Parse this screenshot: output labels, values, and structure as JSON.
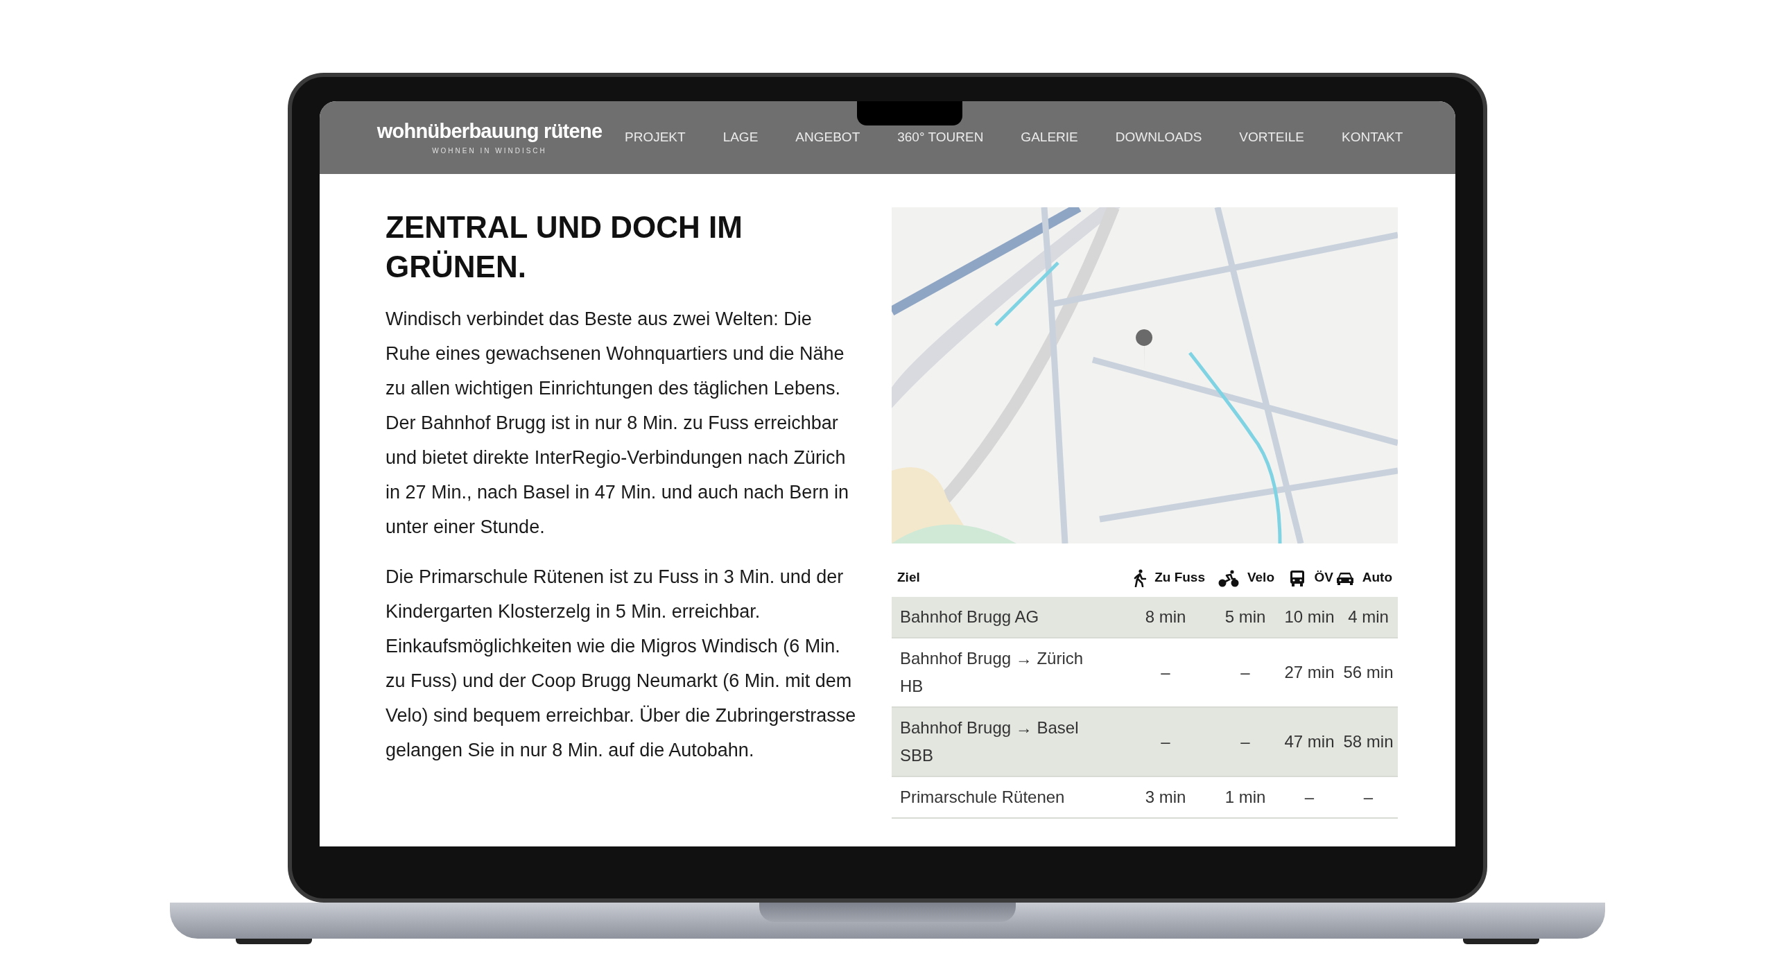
{
  "nav": {
    "logo": "wohnüberbauung rütene",
    "tagline": "WOHNEN IN WINDISCH",
    "items": [
      "PROJEKT",
      "LAGE",
      "ANGEBOT",
      "360° TOUREN",
      "GALERIE",
      "DOWNLOADS",
      "VORTEILE",
      "KONTAKT"
    ]
  },
  "heading": "ZENTRAL UND DOCH IM GRÜNEN.",
  "paragraphs": [
    "Windisch verbindet das Beste aus zwei Welten: Die Ruhe eines gewachsenen Wohnquartiers und die Nähe zu allen wichtigen Einrichtungen des täglichen Lebens. Der Bahnhof Brugg ist in nur 8 Min. zu Fuss erreichbar und bietet direkte InterRegio-Verbindungen nach Zürich in 27 Min., nach Basel in 47 Min. und auch nach Bern in unter einer Stunde.",
    "Die Primarschule Rütenen ist zu Fuss in 3 Min. und der Kindergarten Klosterzelg in 5 Min. erreichbar. Einkaufsmöglichkeiten wie die Migros Windisch (6 Min. zu Fuss) und der Coop Brugg Neumarkt (6 Min. mit dem Velo) sind bequem erreichbar. Über die Zubringerstrasse gelangen Sie in nur 8 Min. auf die Autobahn."
  ],
  "table": {
    "columns": [
      {
        "label": "Ziel"
      },
      {
        "label": "Zu Fuss"
      },
      {
        "label": "Velo"
      },
      {
        "label": "ÖV"
      },
      {
        "label": "Auto"
      }
    ],
    "rows": [
      {
        "cells": [
          "Bahnhof Brugg AG",
          "8 min",
          "5 min",
          "10 min",
          "4 min"
        ]
      },
      {
        "cells": [
          "Bahnhof Brugg → Zürich HB",
          "–",
          "–",
          "27 min",
          "56 min"
        ]
      },
      {
        "cells": [
          "Bahnhof Brugg → Basel SBB",
          "–",
          "–",
          "47 min",
          "58 min"
        ]
      },
      {
        "cells": [
          "Primarschule Rütenen",
          "3 min",
          "1 min",
          "–",
          "–"
        ]
      }
    ]
  }
}
